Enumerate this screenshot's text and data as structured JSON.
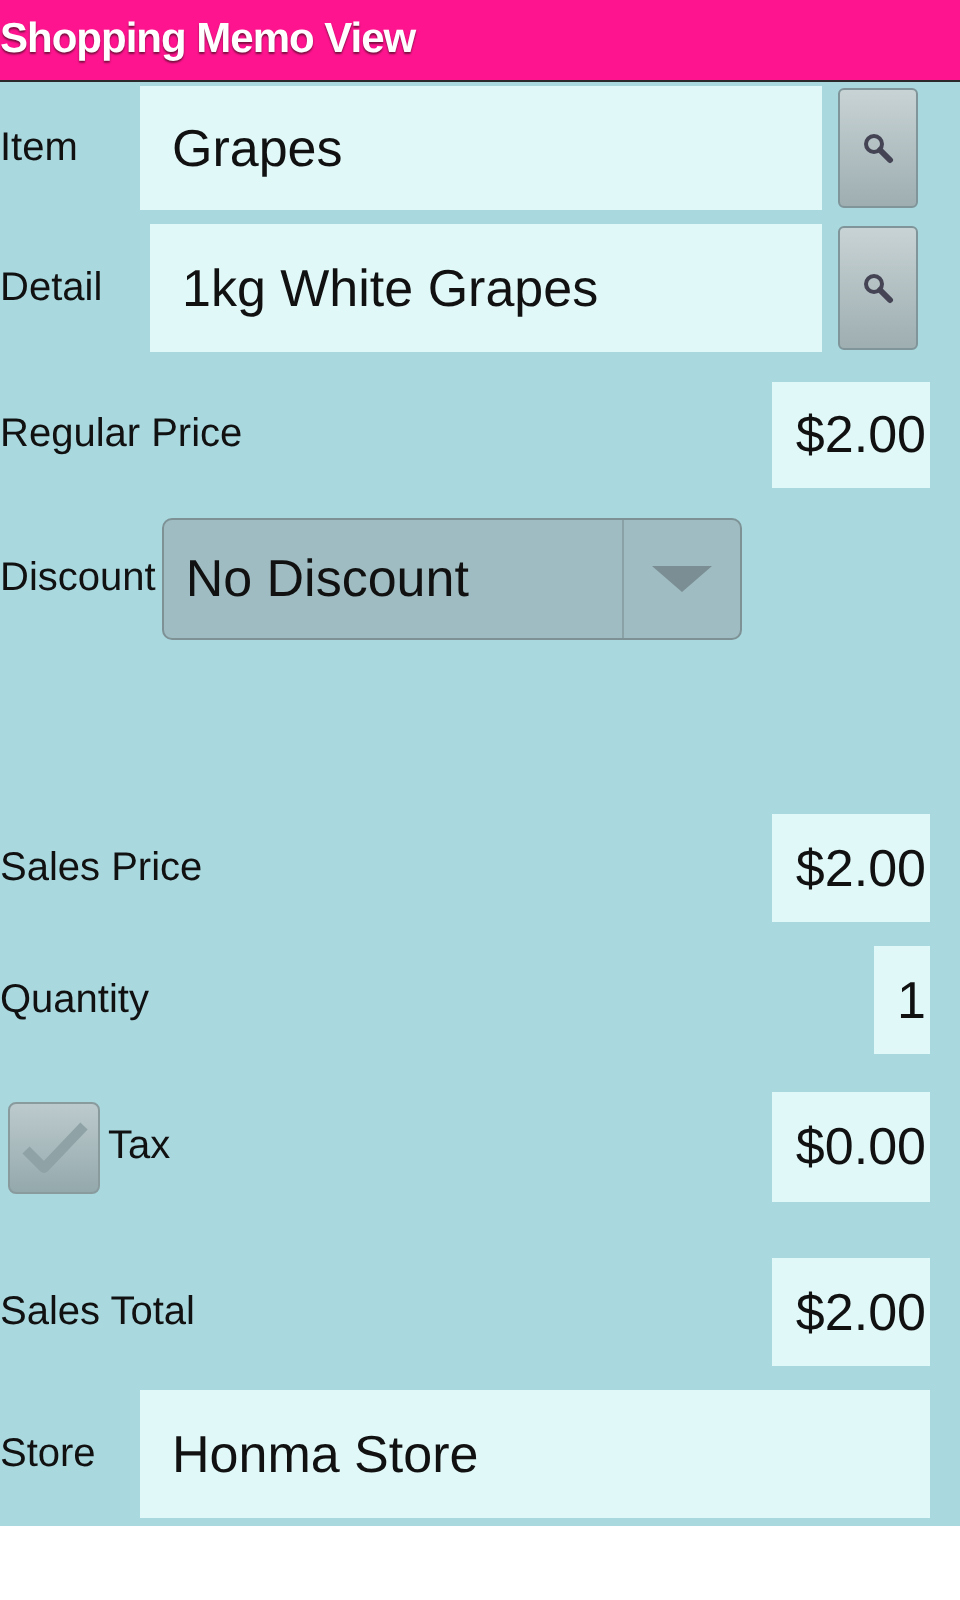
{
  "window": {
    "title": "Shopping Memo View"
  },
  "fields": [
    {
      "kind": "search",
      "label": "Item",
      "value": "Grapes"
    },
    {
      "kind": "search",
      "label": "Detail",
      "value": "1kg White Grapes"
    },
    {
      "kind": "amount",
      "label": "Regular Price",
      "value": "$2.00"
    },
    {
      "kind": "dropdown",
      "label": "Discount",
      "value": "No Discount"
    },
    {
      "kind": "amount",
      "label": "Sales Price",
      "value": "$2.00"
    },
    {
      "kind": "amount",
      "label": "Quantity",
      "value": "1"
    },
    {
      "kind": "check",
      "label": "Tax",
      "checked": true,
      "value": "$0.00"
    },
    {
      "kind": "amount",
      "label": "Sales Total",
      "value": "$2.00"
    },
    {
      "kind": "text",
      "label": "Store",
      "value": "Honma Store"
    }
  ]
}
